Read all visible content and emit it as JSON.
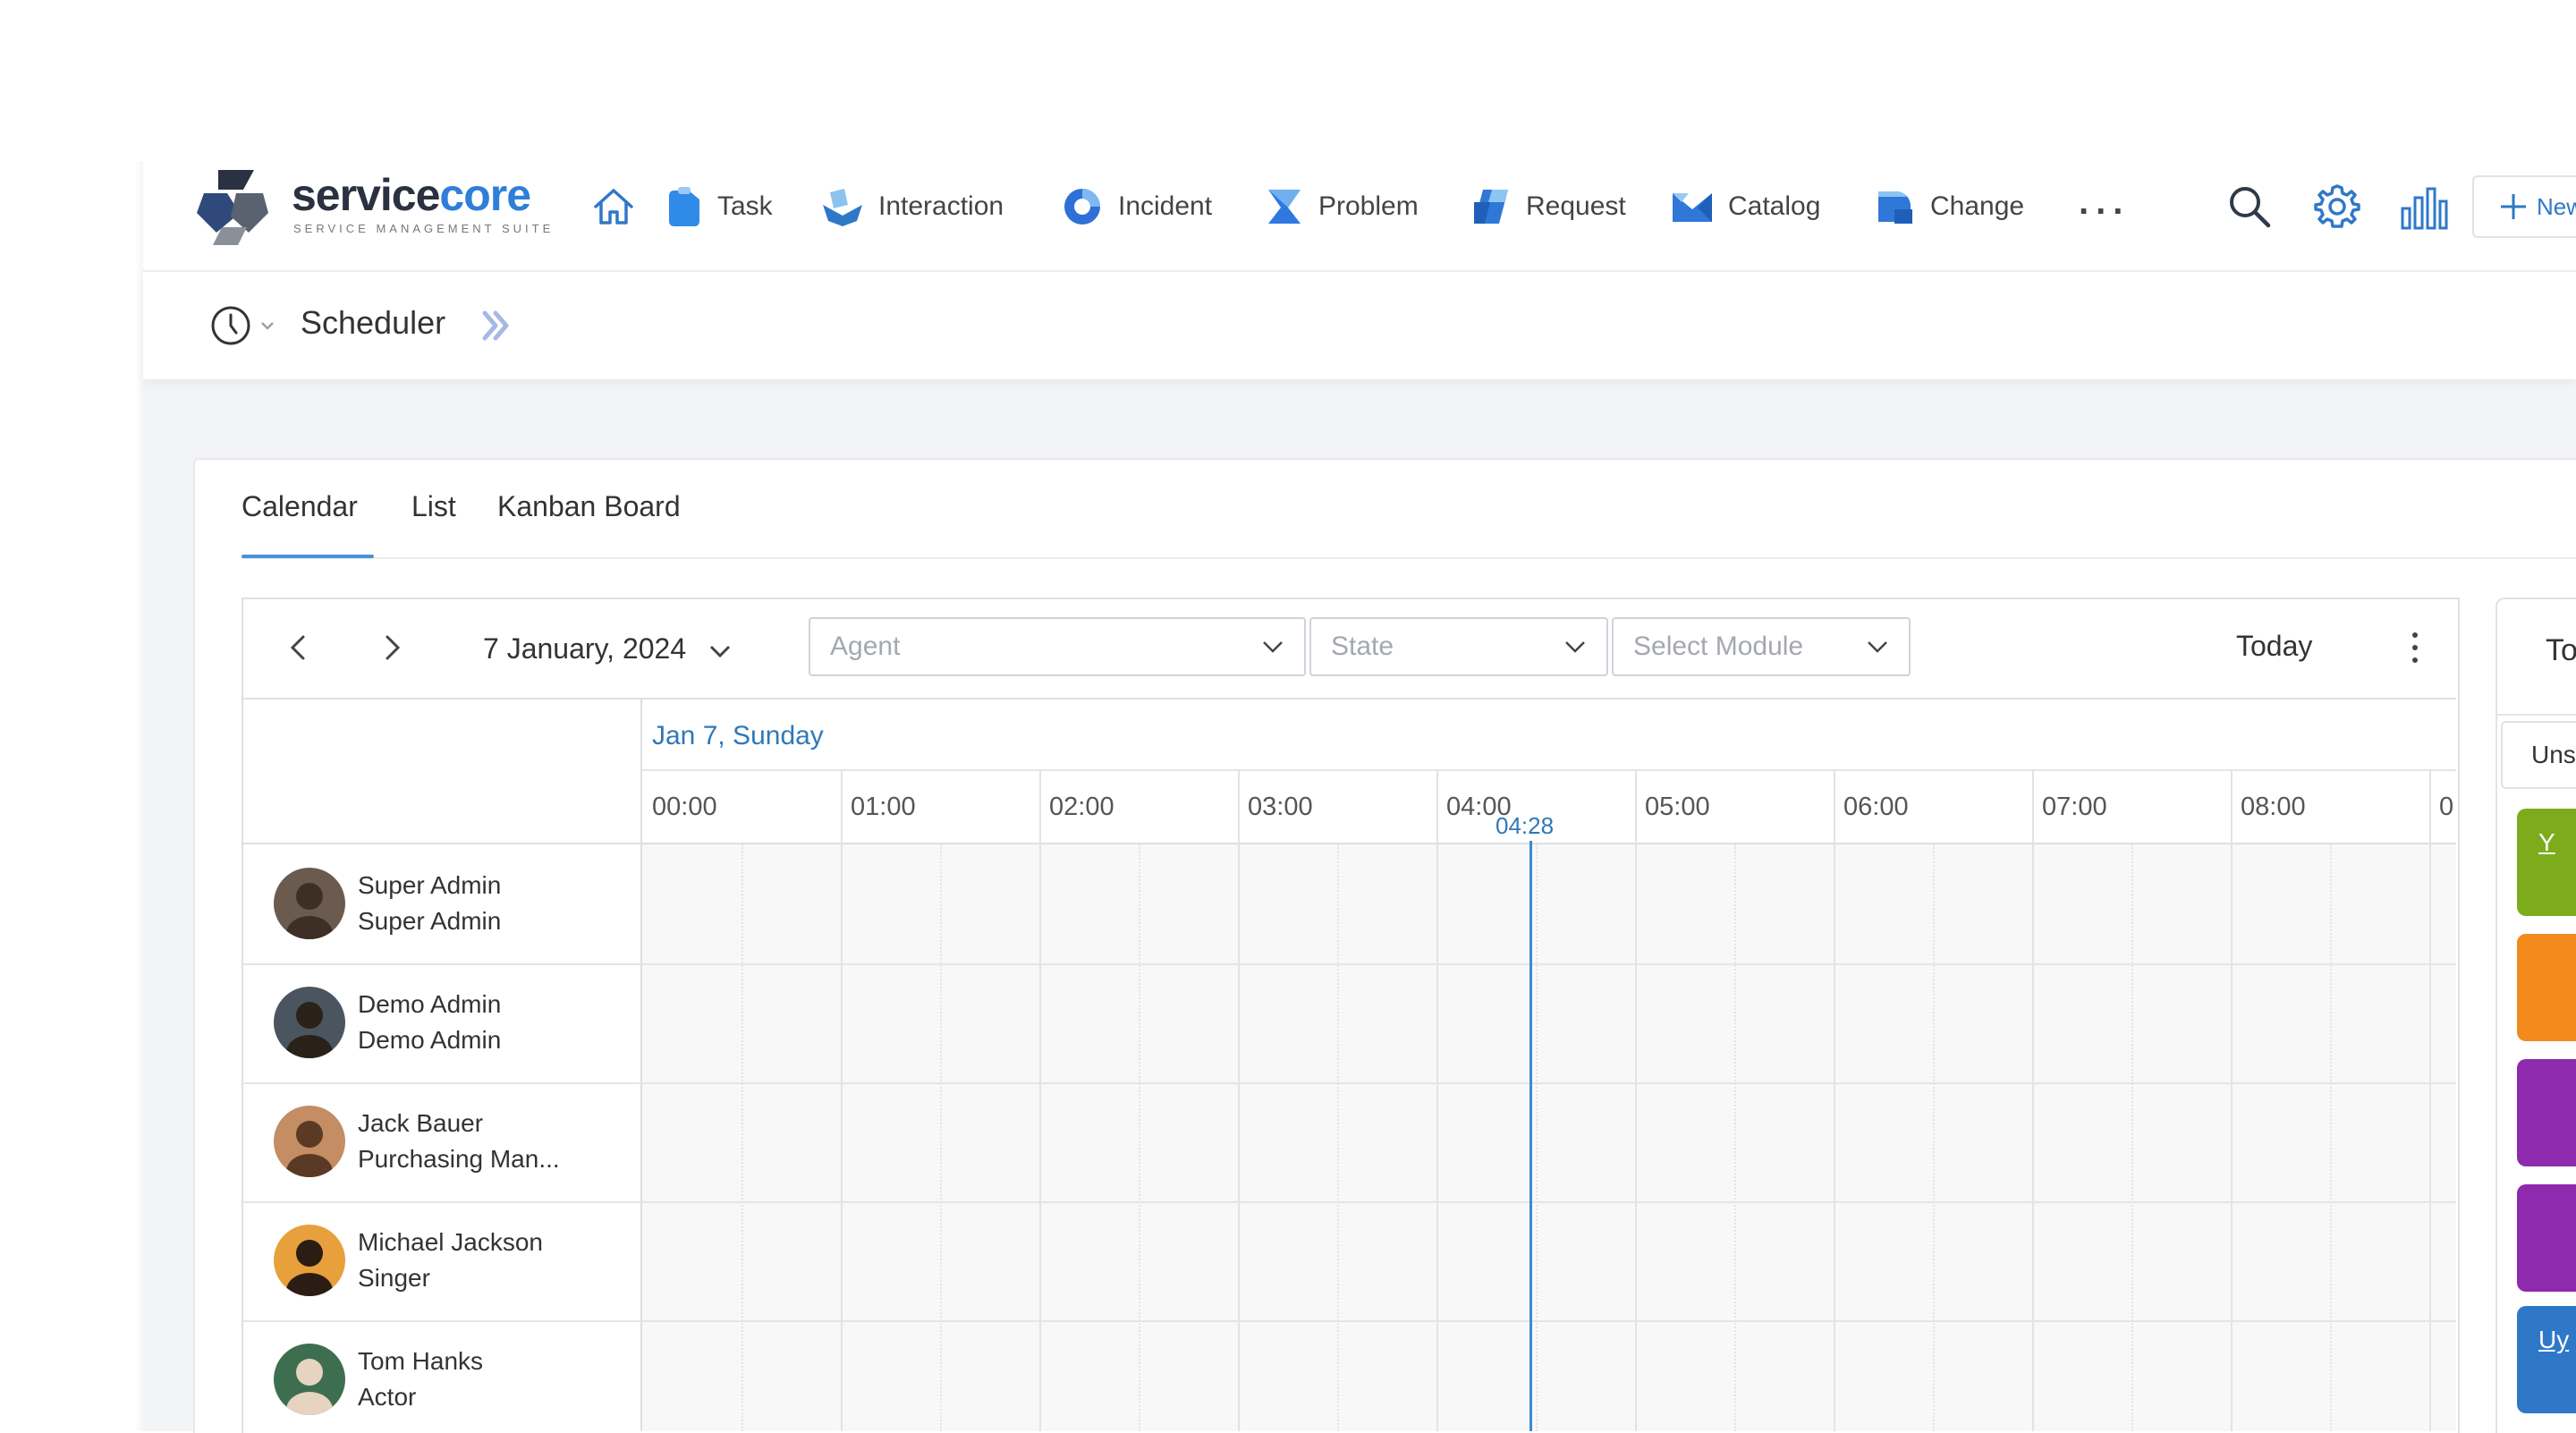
{
  "brand": {
    "name_part1": "service",
    "name_part2": "core",
    "tagline": "SERVICE MANAGEMENT SUITE",
    "color_dark": "#2a3140",
    "color_accent": "#2f7fd8"
  },
  "nav": {
    "items": [
      {
        "label": "Task",
        "icon": "task-icon"
      },
      {
        "label": "Interaction",
        "icon": "interaction-icon"
      },
      {
        "label": "Incident",
        "icon": "incident-icon"
      },
      {
        "label": "Problem",
        "icon": "problem-icon"
      },
      {
        "label": "Request",
        "icon": "request-icon"
      },
      {
        "label": "Catalog",
        "icon": "catalog-icon"
      },
      {
        "label": "Change",
        "icon": "change-icon"
      }
    ],
    "more": "...",
    "new_label": "New"
  },
  "breadcrumb": {
    "title": "Scheduler"
  },
  "tabs": [
    "Calendar",
    "List",
    "Kanban Board"
  ],
  "active_tab": "Calendar",
  "toolbar": {
    "date": "7 January, 2024",
    "agent_placeholder": "Agent",
    "state_placeholder": "State",
    "module_placeholder": "Select Module",
    "today": "Today"
  },
  "calendar": {
    "day_label": "Jan 7, Sunday",
    "hours": [
      "00:00",
      "01:00",
      "02:00",
      "03:00",
      "04:00",
      "05:00",
      "06:00",
      "07:00",
      "08:00",
      "0"
    ],
    "current_time": "04:28"
  },
  "resources": [
    {
      "name": "Super Admin",
      "role": "Super Admin"
    },
    {
      "name": "Demo Admin",
      "role": "Demo Admin"
    },
    {
      "name": "Jack Bauer",
      "role": "Purchasing Man..."
    },
    {
      "name": "Michael Jackson",
      "role": "Singer"
    },
    {
      "name": "Tom Hanks",
      "role": "Actor"
    }
  ],
  "right_panel": {
    "title": "To",
    "tab": "Uns",
    "chips": [
      {
        "color": "#7cac1c",
        "text": "Y"
      },
      {
        "color": "#f28a1c",
        "text": ""
      },
      {
        "color": "#8e2aad",
        "text": ""
      },
      {
        "color": "#8e2aad",
        "text": ""
      },
      {
        "color": "#2f78c8",
        "text": "Uy"
      }
    ]
  }
}
